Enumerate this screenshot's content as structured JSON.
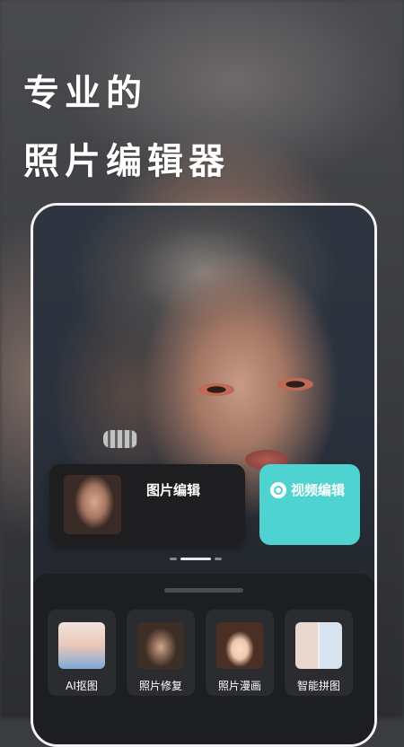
{
  "headline": {
    "line1": "专业的",
    "line2": "照片编辑器"
  },
  "cards": {
    "photo_edit_label": "图片编辑",
    "video_edit_label": "视频编辑"
  },
  "carousel": {
    "active_index": 1,
    "count": 3
  },
  "tools": [
    {
      "label": "AI抠图",
      "icon": "ai-cutout-thumbnail"
    },
    {
      "label": "照片修复",
      "icon": "photo-restore-thumbnail"
    },
    {
      "label": "照片漫画",
      "icon": "photo-cartoon-thumbnail"
    },
    {
      "label": "智能拼图",
      "icon": "smart-collage-thumbnail"
    }
  ],
  "colors": {
    "accent": "#4fd3d0",
    "card": "#1e1e21",
    "panel": "#1d1e21"
  }
}
